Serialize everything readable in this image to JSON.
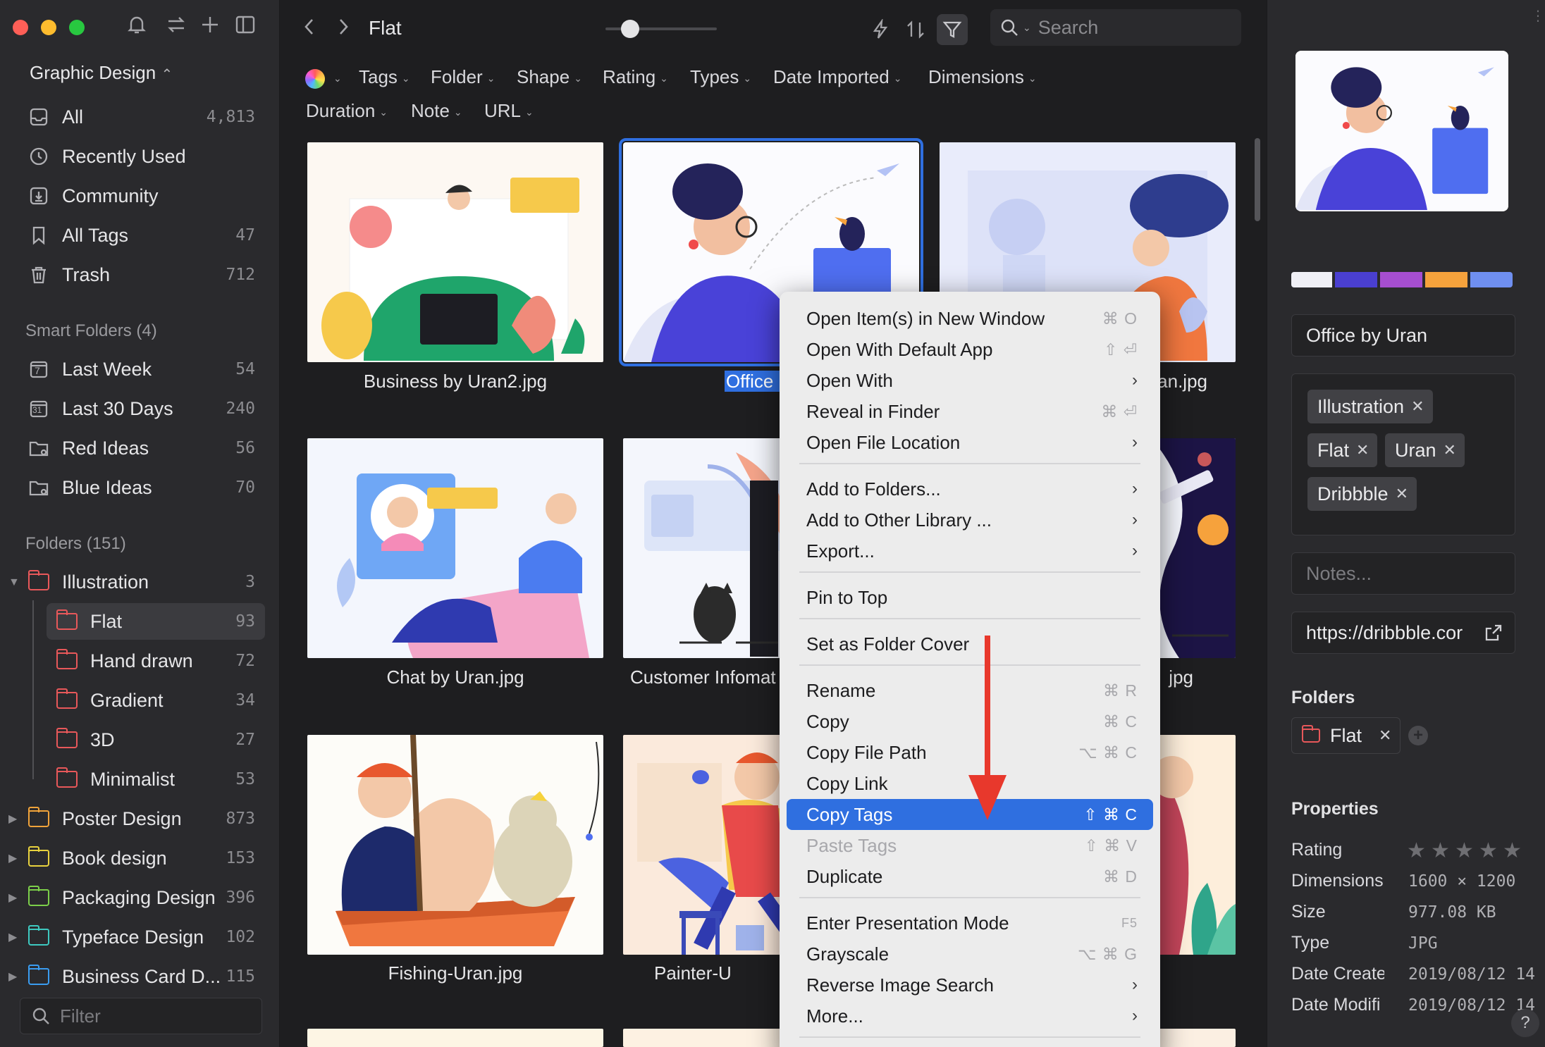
{
  "sidebar": {
    "library": "Graphic Design",
    "items": [
      {
        "label": "All",
        "count": "4,813"
      },
      {
        "label": "Recently Used",
        "count": ""
      },
      {
        "label": "Community",
        "count": ""
      },
      {
        "label": "All Tags",
        "count": "47"
      },
      {
        "label": "Trash",
        "count": "712"
      }
    ],
    "smart_header": "Smart Folders (4)",
    "smart": [
      {
        "label": "Last Week",
        "count": "54",
        "icon_text": "7"
      },
      {
        "label": "Last 30 Days",
        "count": "240",
        "icon_text": "31"
      },
      {
        "label": "Red Ideas",
        "count": "56"
      },
      {
        "label": "Blue Ideas",
        "count": "70"
      }
    ],
    "folders_header": "Folders (151)",
    "folders": [
      {
        "label": "Illustration",
        "count": "3",
        "color": "#e8585a"
      },
      {
        "label": "Flat",
        "count": "93",
        "color": "#e8585a"
      },
      {
        "label": "Hand drawn",
        "count": "72",
        "color": "#e8585a"
      },
      {
        "label": "Gradient",
        "count": "34",
        "color": "#e8585a"
      },
      {
        "label": "3D",
        "count": "27",
        "color": "#e8585a"
      },
      {
        "label": "Minimalist",
        "count": "53",
        "color": "#e8585a"
      },
      {
        "label": "Poster Design",
        "count": "873",
        "color": "#f0a33a"
      },
      {
        "label": "Book design",
        "count": "153",
        "color": "#e8d23e"
      },
      {
        "label": "Packaging Design",
        "count": "396",
        "color": "#7ccf4a"
      },
      {
        "label": "Typeface Design",
        "count": "102",
        "color": "#3ec9c0"
      },
      {
        "label": "Business Card D...",
        "count": "115",
        "color": "#3a9cf0"
      }
    ],
    "filter_placeholder": "Filter"
  },
  "toolbar": {
    "title": "Flat",
    "search_placeholder": "Search",
    "filters": [
      "Tags",
      "Folder",
      "Shape",
      "Rating",
      "Types",
      "Date Imported",
      "Dimensions",
      "Duration",
      "Note",
      "URL"
    ]
  },
  "grid": {
    "captions": [
      "Business by Uran2.jpg",
      "Office by U",
      "Uran.jpg",
      "Chat by Uran.jpg",
      "Customer Infomat",
      "jpg",
      "Fishing-Uran.jpg",
      "Painter-U"
    ]
  },
  "context_menu": {
    "items": [
      {
        "label": "Open Item(s) in New Window",
        "shortcut": "⌘ O"
      },
      {
        "label": "Open With Default App",
        "shortcut": "⇧ ⏎"
      },
      {
        "label": "Open With",
        "shortcut": ""
      },
      {
        "label": "Reveal in Finder",
        "shortcut": "⌘ ⏎"
      },
      {
        "label": "Open File Location",
        "shortcut": ""
      },
      {
        "label": "Add to Folders...",
        "shortcut": ""
      },
      {
        "label": "Add to Other Library ...",
        "shortcut": ""
      },
      {
        "label": "Export...",
        "shortcut": ""
      },
      {
        "label": "Pin to Top",
        "shortcut": ""
      },
      {
        "label": "Set as Folder Cover",
        "shortcut": ""
      },
      {
        "label": "Rename",
        "shortcut": "⌘ R"
      },
      {
        "label": "Copy",
        "shortcut": "⌘ C"
      },
      {
        "label": "Copy File Path",
        "shortcut": "⌥ ⌘ C"
      },
      {
        "label": "Copy Link",
        "shortcut": ""
      },
      {
        "label": "Copy Tags",
        "shortcut": "⇧ ⌘ C"
      },
      {
        "label": "Paste Tags",
        "shortcut": "⇧ ⌘ V"
      },
      {
        "label": "Duplicate",
        "shortcut": "⌘ D"
      },
      {
        "label": "Enter Presentation Mode",
        "shortcut": "F5"
      },
      {
        "label": "Grayscale",
        "shortcut": "⌥ ⌘ G"
      },
      {
        "label": "Reverse Image Search",
        "shortcut": ""
      },
      {
        "label": "More...",
        "shortcut": ""
      }
    ]
  },
  "inspector": {
    "palette": [
      "#f0f0f6",
      "#4a3fd0",
      "#a64ed0",
      "#f5a23c",
      "#6f8ff0"
    ],
    "name": "Office by Uran",
    "tags": [
      "Illustration",
      "Flat",
      "Uran",
      "Dribbble"
    ],
    "notes_placeholder": "Notes...",
    "url": "https://dribbble.cor",
    "folders_header": "Folders",
    "folder_chip": "Flat",
    "properties_header": "Properties",
    "props": [
      {
        "key": "Rating",
        "value": ""
      },
      {
        "key": "Dimensions",
        "value": "1600 × 1200"
      },
      {
        "key": "Size",
        "value": "977.08 KB"
      },
      {
        "key": "Type",
        "value": "JPG"
      },
      {
        "key": "Date Create",
        "value": "2019/08/12 14"
      },
      {
        "key": "Date Modifi",
        "value": "2019/08/12 14"
      }
    ],
    "help": "?"
  }
}
